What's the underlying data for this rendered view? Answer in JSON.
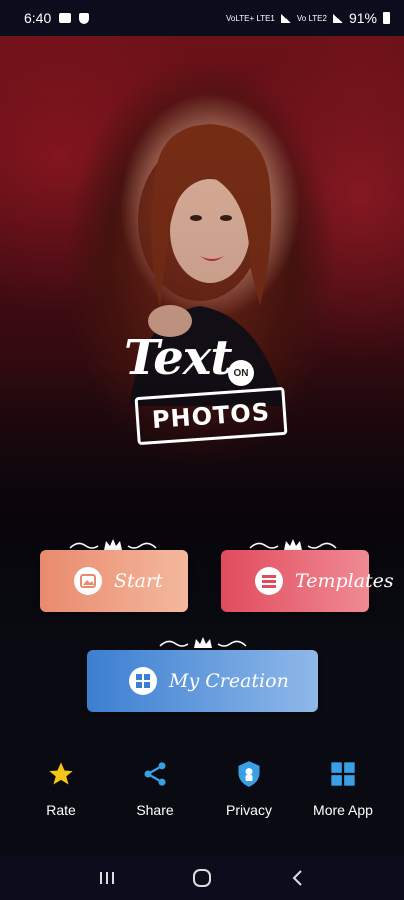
{
  "status_bar": {
    "time": "6:40",
    "network_1": "VoLTE+ LTE1",
    "network_2": "Vo LTE2",
    "battery": "91%",
    "left_icons": [
      "message-icon",
      "shield-icon"
    ],
    "right_icons": [
      "signal-icon",
      "signal-icon",
      "battery-icon"
    ]
  },
  "logo": {
    "line1": "Text",
    "on": "ON",
    "line2": "PHOTOS"
  },
  "buttons": {
    "start": {
      "label": "Start",
      "icon": "image-icon"
    },
    "templates": {
      "label": "Templates",
      "icon": "list-icon"
    },
    "my_creation": {
      "label": "My Creation",
      "icon": "grid-icon"
    }
  },
  "bottom_actions": [
    {
      "label": "Rate",
      "icon": "star-icon",
      "color": "#f5c518"
    },
    {
      "label": "Share",
      "icon": "share-icon",
      "color": "#3aa0e6"
    },
    {
      "label": "Privacy",
      "icon": "shield-lock-icon",
      "color": "#3aa0e6"
    },
    {
      "label": "More App",
      "icon": "apps-grid-icon",
      "color": "#3aa0e6"
    }
  ],
  "nav_bar": {
    "items": [
      "recents-icon",
      "home-icon",
      "back-icon"
    ]
  },
  "colors": {
    "start": "#e98a6e",
    "templates": "#e04c5e",
    "creation": "#3b7fd0",
    "accent_blue": "#3aa0e6",
    "star": "#f5c518"
  }
}
